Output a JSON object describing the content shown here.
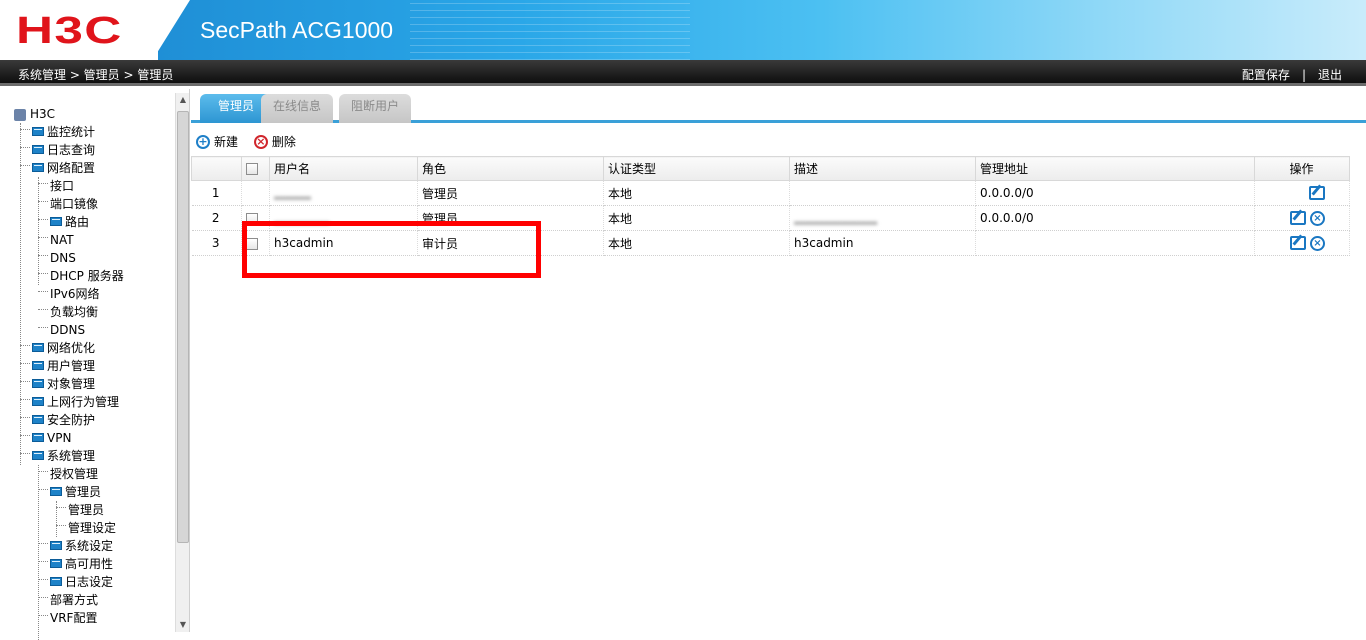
{
  "header": {
    "brand": "H3C",
    "product": "SecPath ACG1000"
  },
  "topbar": {
    "breadcrumb": "系统管理 > 管理员 > 管理员",
    "save_config": "配置保存",
    "separator": "|",
    "logout": "退出"
  },
  "sidebar": {
    "root": "H3C",
    "items": [
      {
        "label": "监控统计"
      },
      {
        "label": "日志查询"
      },
      {
        "label": "网络配置"
      },
      {
        "label": "接口"
      },
      {
        "label": "端口镜像"
      },
      {
        "label": "路由"
      },
      {
        "label": "NAT"
      },
      {
        "label": "DNS"
      },
      {
        "label": "DHCP 服务器"
      },
      {
        "label": "IPv6网络"
      },
      {
        "label": "负载均衡"
      },
      {
        "label": "DDNS"
      },
      {
        "label": "网络优化"
      },
      {
        "label": "用户管理"
      },
      {
        "label": "对象管理"
      },
      {
        "label": "上网行为管理"
      },
      {
        "label": "安全防护"
      },
      {
        "label": "VPN"
      },
      {
        "label": "系统管理"
      },
      {
        "label": "授权管理"
      },
      {
        "label": "管理员"
      },
      {
        "label": "管理员"
      },
      {
        "label": "管理设定"
      },
      {
        "label": "系统设定"
      },
      {
        "label": "高可用性"
      },
      {
        "label": "日志设定"
      },
      {
        "label": "部署方式"
      },
      {
        "label": "VRF配置"
      }
    ]
  },
  "tabs": [
    {
      "label": "管理员",
      "active": true
    },
    {
      "label": "在线信息",
      "active": false
    },
    {
      "label": "阻断用户",
      "active": false
    }
  ],
  "toolbar": {
    "new_label": "新建",
    "delete_label": "删除"
  },
  "table": {
    "headers": {
      "username": "用户名",
      "role": "角色",
      "auth_type": "认证类型",
      "description": "描述",
      "mgmt_address": "管理地址",
      "ops": "操作"
    },
    "rows": [
      {
        "index": "1",
        "username": "",
        "role": "管理员",
        "auth_type": "本地",
        "description": "",
        "mgmt_address": "0.0.0.0/0"
      },
      {
        "index": "2",
        "username": "",
        "role": "管理员",
        "auth_type": "本地",
        "description": "",
        "mgmt_address": "0.0.0.0/0"
      },
      {
        "index": "3",
        "username": "h3cadmin",
        "role": "审计员",
        "auth_type": "本地",
        "description": "h3cadmin",
        "mgmt_address": ""
      }
    ]
  },
  "colors": {
    "brand_red": "#e0141b",
    "accent_blue": "#2d95d2",
    "highlight": "#ff0000"
  }
}
